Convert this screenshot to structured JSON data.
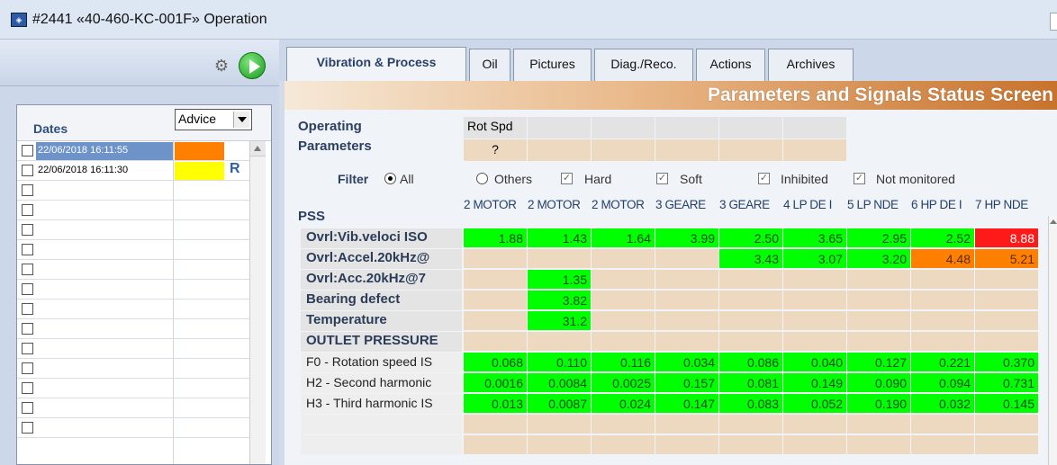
{
  "window": {
    "title": "#2441 «40-460-KC-001F» Operation"
  },
  "left": {
    "dates_label": "Dates",
    "advice_select": "Advice",
    "rows": [
      {
        "date": "22/06/2018 16:11:55",
        "advice_color": "#ff8000",
        "selected": true,
        "mark": ""
      },
      {
        "date": "22/06/2018 16:11:30",
        "advice_color": "#ffff00",
        "selected": false,
        "mark": "R"
      }
    ],
    "empty_rows": 13
  },
  "tabs": [
    {
      "label": "Vibration & Process",
      "active": true
    },
    {
      "label": "Oil"
    },
    {
      "label": "Pictures"
    },
    {
      "label": "Diag./Reco."
    },
    {
      "label": "Actions"
    },
    {
      "label": "Archives"
    }
  ],
  "main": {
    "banner": "Parameters and Signals Status Screen",
    "operating_label_1": "Operating",
    "operating_label_2": "Parameters",
    "op_param_name": "Rot Spd",
    "op_param_value": "?",
    "filter": {
      "label": "Filter",
      "all": "All",
      "others": "Others",
      "hard": "Hard",
      "soft": "Soft",
      "inhibited": "Inhibited",
      "not_monitored": "Not monitored"
    },
    "pss_label": "PSS",
    "columns": [
      "2 MOTOR",
      "2 MOTOR",
      "2 MOTOR",
      "3 GEARE",
      "3 GEARE",
      "4 LP DE I",
      "5 LP NDE",
      "6 HP DE I",
      "7 HP NDE"
    ],
    "rows": [
      {
        "label": "Ovrl:Vib.veloci ISO",
        "style": "bold",
        "values": [
          "1.88",
          "1.43",
          "1.64",
          "3.99",
          "2.50",
          "3.65",
          "2.95",
          "2.52",
          "8.88"
        ],
        "colors": [
          "g",
          "g",
          "g",
          "g",
          "g",
          "g",
          "g",
          "g",
          "r"
        ]
      },
      {
        "label": "Ovrl:Accel.20kHz@",
        "style": "bold",
        "values": [
          "",
          "",
          "",
          "",
          "3.43",
          "3.07",
          "3.20",
          "4.48",
          "5.21"
        ],
        "colors": [
          "t",
          "t",
          "t",
          "t",
          "g",
          "g",
          "g",
          "o",
          "o"
        ]
      },
      {
        "label": "Ovrl:Acc.20kHz@7",
        "style": "bold",
        "values": [
          "",
          "1.35",
          "",
          "",
          "",
          "",
          "",
          "",
          ""
        ],
        "colors": [
          "t",
          "g",
          "t",
          "t",
          "t",
          "t",
          "t",
          "t",
          "t"
        ]
      },
      {
        "label": "Bearing defect",
        "style": "bold",
        "values": [
          "",
          "3.82",
          "",
          "",
          "",
          "",
          "",
          "",
          ""
        ],
        "colors": [
          "t",
          "g",
          "t",
          "t",
          "t",
          "t",
          "t",
          "t",
          "t"
        ]
      },
      {
        "label": "Temperature",
        "style": "bold",
        "values": [
          "",
          "31.2",
          "",
          "",
          "",
          "",
          "",
          "",
          ""
        ],
        "colors": [
          "t",
          "g",
          "t",
          "t",
          "t",
          "t",
          "t",
          "t",
          "t"
        ]
      },
      {
        "label": "OUTLET PRESSURE",
        "style": "bold",
        "values": [
          "",
          "",
          "",
          "",
          "",
          "",
          "",
          "",
          ""
        ],
        "colors": [
          "t",
          "t",
          "t",
          "t",
          "t",
          "t",
          "t",
          "t",
          "t"
        ]
      },
      {
        "label": "F0 - Rotation speed IS",
        "style": "plain",
        "values": [
          "0.068",
          "0.110",
          "0.116",
          "0.034",
          "0.086",
          "0.040",
          "0.127",
          "0.221",
          "0.370"
        ],
        "colors": [
          "g",
          "g",
          "g",
          "g",
          "g",
          "g",
          "g",
          "g",
          "g"
        ]
      },
      {
        "label": "H2 - Second harmonic",
        "style": "plain",
        "values": [
          "0.0016",
          "0.0084",
          "0.0025",
          "0.157",
          "0.081",
          "0.149",
          "0.090",
          "0.094",
          "0.731"
        ],
        "colors": [
          "g",
          "g",
          "g",
          "g",
          "g",
          "g",
          "g",
          "g",
          "g"
        ]
      },
      {
        "label": "H3 - Third harmonic IS",
        "style": "plain",
        "values": [
          "0.013",
          "0.0087",
          "0.024",
          "0.147",
          "0.083",
          "0.052",
          "0.190",
          "0.032",
          "0.145"
        ],
        "colors": [
          "g",
          "g",
          "g",
          "g",
          "g",
          "g",
          "g",
          "g",
          "g"
        ]
      },
      {
        "label": "",
        "style": "plain",
        "values": [
          "",
          "",
          "",
          "",
          "",
          "",
          "",
          "",
          ""
        ],
        "colors": [
          "t",
          "t",
          "t",
          "t",
          "t",
          "t",
          "t",
          "t",
          "t"
        ]
      },
      {
        "label": "",
        "style": "plain",
        "values": [
          "",
          "",
          "",
          "",
          "",
          "",
          "",
          "",
          ""
        ],
        "colors": [
          "t",
          "t",
          "t",
          "t",
          "t",
          "t",
          "t",
          "t",
          "t"
        ]
      }
    ],
    "status_colors": {
      "g": "#00ff00",
      "r": "#ff1a1a",
      "o": "#ff8000",
      "t": "#ecd9c0"
    }
  }
}
